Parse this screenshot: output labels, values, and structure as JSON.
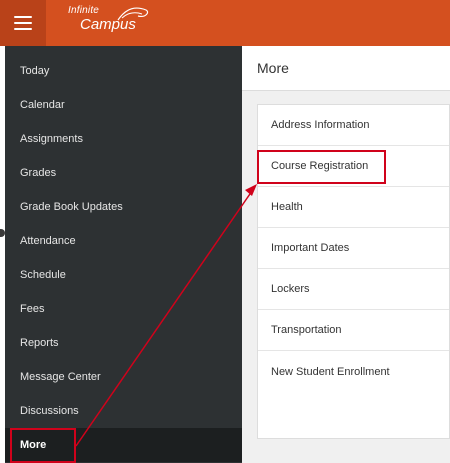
{
  "app": {
    "logo_line1": "Infinite",
    "logo_line2": "Campus"
  },
  "header": {
    "title": "More"
  },
  "sidebar": {
    "items": [
      {
        "label": "Today"
      },
      {
        "label": "Calendar"
      },
      {
        "label": "Assignments"
      },
      {
        "label": "Grades"
      },
      {
        "label": "Grade Book Updates"
      },
      {
        "label": "Attendance"
      },
      {
        "label": "Schedule"
      },
      {
        "label": "Fees"
      },
      {
        "label": "Reports"
      },
      {
        "label": "Message Center"
      },
      {
        "label": "Discussions"
      },
      {
        "label": "More"
      }
    ],
    "active": "More"
  },
  "more_list": {
    "items": [
      {
        "label": "Address Information"
      },
      {
        "label": "Course Registration"
      },
      {
        "label": "Health"
      },
      {
        "label": "Important Dates"
      },
      {
        "label": "Lockers"
      },
      {
        "label": "Transportation"
      },
      {
        "label": "New Student Enrollment"
      }
    ]
  },
  "colors": {
    "brand": "#d4501f",
    "sidebar_bg": "#2d3133",
    "annotation": "#d0021b"
  }
}
